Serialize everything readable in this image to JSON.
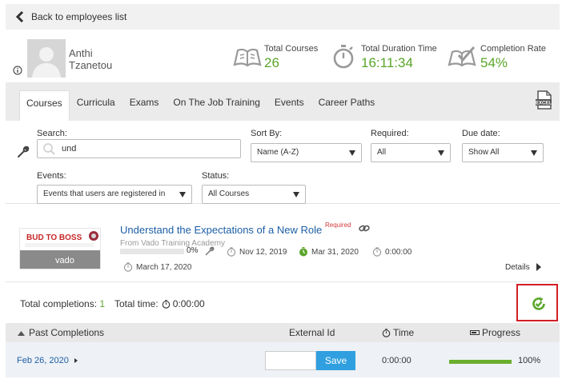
{
  "nav": {
    "back_label": "Back to employees list"
  },
  "profile": {
    "first_name": "Anthi",
    "last_name": "Tzanetou"
  },
  "stats": {
    "total_courses_label": "Total Courses",
    "total_courses_value": "26",
    "total_duration_label": "Total Duration Time",
    "total_duration_value": "16:11:34",
    "completion_rate_label": "Completion Rate",
    "completion_rate_value": "54%",
    "accent_color": "#5aa52a"
  },
  "tabs": [
    {
      "label": "Courses",
      "active": true
    },
    {
      "label": "Curricula",
      "active": false
    },
    {
      "label": "Exams",
      "active": false
    },
    {
      "label": "On The Job Training",
      "active": false
    },
    {
      "label": "Events",
      "active": false
    },
    {
      "label": "Career Paths",
      "active": false
    }
  ],
  "filters": {
    "search_label": "Search:",
    "search_value": "und",
    "sort_label": "Sort By:",
    "sort_value": "Name (A-Z)",
    "required_label": "Required:",
    "required_value": "All",
    "due_label": "Due date:",
    "due_value": "Show All",
    "events_label": "Events:",
    "events_value": "Events that users are registered in",
    "status_label": "Status:",
    "status_value": "All Courses"
  },
  "course": {
    "title": "Understand the Expectations of a New Role",
    "required_tag": "Required",
    "from": "From Vado Training Academy",
    "progress_pct": "0%",
    "progress_fraction": 0,
    "date_1": "Nov 12, 2019",
    "date_2": "Mar 31, 2020",
    "duration": "0:00:00",
    "date_3": "March 17, 2020",
    "details_label": "Details",
    "thumb_title": "BUD TO BOSS",
    "thumb_brand": "vado"
  },
  "totals": {
    "completions_label": "Total completions:",
    "completions_value": "1",
    "time_label": "Total time:",
    "time_value": "0:00:00"
  },
  "past": {
    "header_title": "Past Completions",
    "header_ext": "External Id",
    "header_time": "Time",
    "header_progress": "Progress",
    "rows": [
      {
        "date": "Feb 26, 2020",
        "ext_id": "",
        "save_label": "Save",
        "time": "0:00:00",
        "progress": "100%",
        "progress_fraction": 1
      }
    ]
  },
  "colors": {
    "link": "#1d5fa5",
    "green": "#5aa52a",
    "save_blue": "#2f9fe0",
    "highlight_red": "#d21f26"
  }
}
